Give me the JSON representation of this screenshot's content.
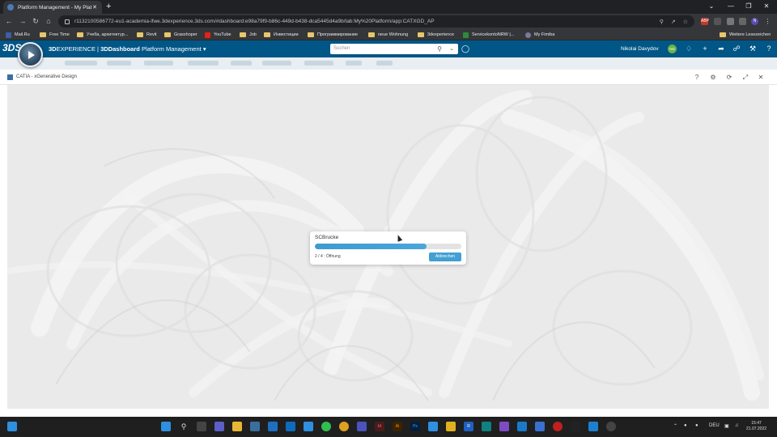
{
  "browser": {
    "tab_title": "Platform Management - My Plat",
    "tab_close": "✕",
    "new_tab": "+",
    "url": "r1132100586772-eu1-academia-ifwe.3dexperience.3ds.com/#dashboard:e98a79f9-b86c-449d-b438-dca5445d4a9b/tab:My%20Platform/app:CATXGD_AP",
    "window_controls": [
      "⌄",
      "—",
      "❐",
      "✕"
    ]
  },
  "bookmarks": [
    {
      "label": "Mail.Ru",
      "kind": "site",
      "color": "#3b5ea8"
    },
    {
      "label": "Free Time",
      "kind": "folder"
    },
    {
      "label": "Учеба, архитектур...",
      "kind": "folder"
    },
    {
      "label": "Revit",
      "kind": "folder"
    },
    {
      "label": "Grasshoper",
      "kind": "folder"
    },
    {
      "label": "YouTube",
      "kind": "site",
      "color": "#e62117"
    },
    {
      "label": "Job",
      "kind": "folder"
    },
    {
      "label": "Инвестиции",
      "kind": "folder"
    },
    {
      "label": "Программирование",
      "kind": "folder"
    },
    {
      "label": "neue Wohnung",
      "kind": "folder"
    },
    {
      "label": "3dexperience",
      "kind": "folder"
    },
    {
      "label": "ServicekontoNRW |...",
      "kind": "site",
      "color": "#2e8b3a"
    },
    {
      "label": "My Fimiba",
      "kind": "site",
      "color": "#7a7a9a"
    }
  ],
  "bookmarks_other": "Weitere Lesezeichen",
  "app": {
    "brand_3d": "3D",
    "brand_experience": "EXPERIENCE",
    "brand_sep": "|",
    "brand_dashboard": "3DDashboard",
    "brand_role": "Platform Management",
    "search_placeholder": "Suchen",
    "user_name": "Nikolai Davydov",
    "user_initials": "ND"
  },
  "widget": {
    "title": "CATIA - xGenerative Design",
    "buttons": [
      "?",
      "⚙",
      "⟳",
      "⤢",
      "✕"
    ]
  },
  "dialog": {
    "title": "SCBrucke",
    "progress": 0.76,
    "step_text": "2 / 4 : Öffnung",
    "cancel_label": "Abbrechen"
  },
  "taskbar": {
    "language": "DEU",
    "time": "15:47",
    "date": "21.07.2022"
  },
  "colors": {
    "app_bar": "#005686",
    "progress_fill": "#3e9bd0",
    "cancel_button": "#42a0d2"
  }
}
